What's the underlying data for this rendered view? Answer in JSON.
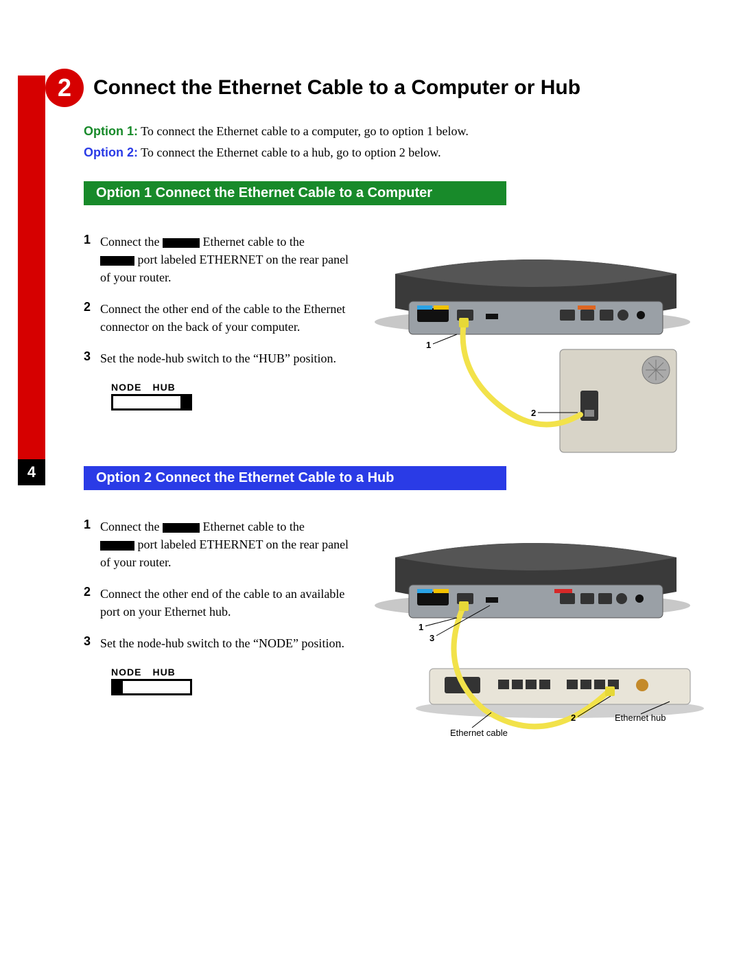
{
  "page_number": "4",
  "step": {
    "number": "2",
    "title": "Connect the Ethernet Cable to a Computer or Hub"
  },
  "intro": {
    "opt1_label": "Option 1:",
    "opt1_text": " To connect the Ethernet cable to a computer, go to option 1 below.",
    "opt2_label": "Option 2:",
    "opt2_text": " To connect the Ethernet cable to a hub, go to option 2 below."
  },
  "option1": {
    "heading": "Option 1   Connect the Ethernet Cable to a Computer",
    "steps": {
      "n1": "1",
      "s1a": "Connect the ",
      "s1b": " Ethernet cable to the ",
      "s1c": " port labeled ETHERNET on the rear panel of your router.",
      "n2": "2",
      "s2": "Connect the other end of the cable to the Ethernet connector on the back of your computer.",
      "n3": "3",
      "s3": "Set the node-hub switch to the “HUB” position."
    },
    "switch": {
      "node": "NODE",
      "hub": "HUB"
    },
    "diagram": {
      "callout1": "1",
      "callout2": "2"
    }
  },
  "option2": {
    "heading": "Option 2   Connect the Ethernet Cable to a Hub",
    "steps": {
      "n1": "1",
      "s1a": "Connect the ",
      "s1b": " Ethernet cable to the ",
      "s1c": " port labeled ETHERNET on the rear panel of your router.",
      "n2": "2",
      "s2": "Connect the other end of the cable to an available port on your Ethernet hub.",
      "n3": "3",
      "s3": "Set the node-hub switch to the “NODE” position."
    },
    "switch": {
      "node": "NODE",
      "hub": "HUB"
    },
    "diagram": {
      "callout1": "1",
      "callout2": "2",
      "callout3": "3",
      "label_cable": "Ethernet cable",
      "label_hub": "Ethernet hub"
    }
  }
}
